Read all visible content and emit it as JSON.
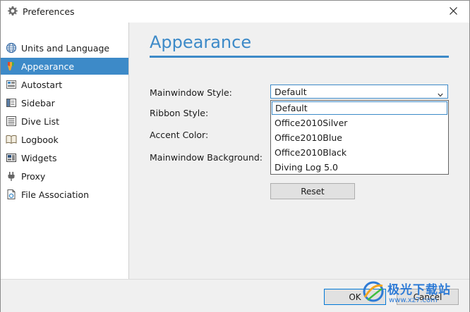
{
  "window": {
    "title": "Preferences"
  },
  "sidebar": {
    "items": [
      {
        "label": "Units and Language",
        "icon": "globe-icon"
      },
      {
        "label": "Appearance",
        "icon": "brush-icon",
        "selected": true
      },
      {
        "label": "Autostart",
        "icon": "autostart-icon"
      },
      {
        "label": "Sidebar",
        "icon": "sidebar-icon"
      },
      {
        "label": "Dive List",
        "icon": "list-icon"
      },
      {
        "label": "Logbook",
        "icon": "book-icon"
      },
      {
        "label": "Widgets",
        "icon": "widget-icon"
      },
      {
        "label": "Proxy",
        "icon": "plug-icon"
      },
      {
        "label": "File Association",
        "icon": "file-icon"
      }
    ]
  },
  "main": {
    "heading": "Appearance",
    "labels": {
      "mainwindow_style": "Mainwindow Style:",
      "ribbon_style": "Ribbon Style:",
      "accent_color": "Accent Color:",
      "mainwindow_background": "Mainwindow Background:"
    },
    "mainwindow_style_select": {
      "value": "Default",
      "options": [
        "Default",
        "Office2010Silver",
        "Office2010Blue",
        "Office2010Black",
        "Diving Log 5.0"
      ]
    },
    "reset_label": "Reset"
  },
  "footer": {
    "ok_label": "OK",
    "cancel_label": "Cancel"
  },
  "watermark": {
    "text": "极光下载站",
    "url": "www.xz7.com"
  },
  "colors": {
    "accent": "#3d8ac8",
    "selection": "#3d8ac8",
    "window_bg": "#f0f0f0"
  }
}
